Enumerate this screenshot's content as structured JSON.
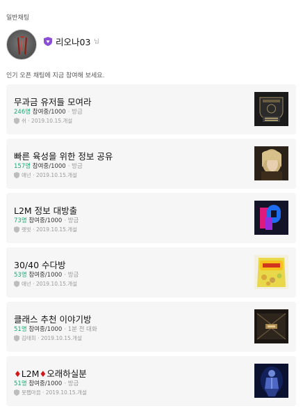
{
  "header": {
    "section_label": "일반채팅"
  },
  "profile": {
    "nickname": "리오나03",
    "nickname_suffix": "님",
    "avatar_icon": "lineage-weapon-avatar",
    "badge_icon": "shield-icon",
    "badge_color": "#8a4fd6"
  },
  "hint": "인기 오픈 채팅에 지금 참여해 보세요.",
  "colors": {
    "count_green": "#1ea571",
    "card_bg": "#f6f6f6"
  },
  "rooms": [
    {
      "title": "무과금 유저들 모여라",
      "count": "246명",
      "capacity": "참여중/1000",
      "time": "· 방금",
      "owner": "쉬 · 2019.10.15.개설",
      "thumb": "emblem-shield-thumb"
    },
    {
      "title": "빠른 육성을 위한 정보 공유",
      "count": "157명",
      "capacity": "참여중/1000",
      "time": "· 방금",
      "owner": "애넌 · 2019.10.15.개설",
      "thumb": "character-portrait-thumb"
    },
    {
      "title": "L2M 정보 대방출",
      "count": "73명",
      "capacity": "참여중/1000",
      "time": "· 방금",
      "owner": "렛빗 · 2019.10.15.개설",
      "thumb": "colorful-logo-thumb"
    },
    {
      "title": "30/40 수다방",
      "count": "53명",
      "capacity": "참여중/1000",
      "time": "· 방금",
      "owner": "애넌 · 2019.10.15.개설",
      "thumb": "snack-bag-thumb"
    },
    {
      "title": "클래스 추천 이야기방",
      "count": "51명",
      "capacity": "참여중/1000",
      "time": "· 1분 전 대화",
      "owner": "김태희 · 2019.10.15.개설",
      "thumb": "dark-hall-thumb"
    },
    {
      "title_prefix": "♦",
      "title_main": "L2M",
      "title_mid": "♦",
      "title_end": "오래하실분",
      "count": "51명",
      "capacity": "참여중/1000",
      "time": "· 방금",
      "owner": "못쨉마끔 · 2019.10.15.개설",
      "thumb": "armored-figure-thumb"
    }
  ]
}
